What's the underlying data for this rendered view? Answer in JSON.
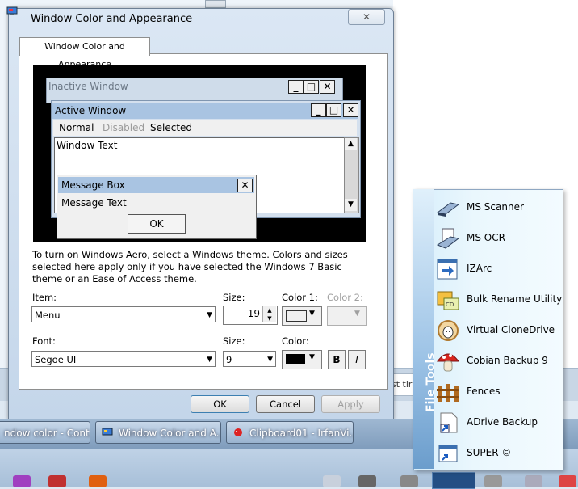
{
  "dialog": {
    "title": "Window Color and Appearance",
    "close_glyph": "✕",
    "tab_label": "Window Color and Appearance"
  },
  "preview": {
    "inactive_title": "Inactive Window",
    "active_title": "Active Window",
    "menu_normal": "Normal",
    "menu_disabled": "Disabled",
    "menu_selected": "Selected",
    "window_text": "Window Text",
    "msgbox_title": "Message Box",
    "msgbox_text": "Message Text",
    "msgbox_ok": "OK",
    "min_glyph": "_",
    "max_glyph": "□",
    "close_glyph": "✕",
    "up_glyph": "▲",
    "down_glyph": "▼"
  },
  "info_text": "To turn on Windows Aero, select a Windows theme.  Colors and sizes selected here apply only if you have selected the Windows 7 Basic theme or an Ease of Access theme.",
  "form": {
    "item_label": "Item:",
    "item_value": "Menu",
    "size1_label": "Size:",
    "size1_value": "19",
    "color1_label": "Color 1:",
    "color2_label": "Color 2:",
    "font_label": "Font:",
    "font_value": "Segoe UI",
    "size2_label": "Size:",
    "size2_value": "9",
    "color3_label": "Color:",
    "bold_label": "B",
    "italic_label": "I",
    "arrow": "▼"
  },
  "buttons": {
    "ok": "OK",
    "cancel": "Cancel",
    "apply": "Apply"
  },
  "taskbar": {
    "task1": "ndow color - Cont...",
    "task2": "Window Color and A...",
    "task3": "Clipboard01 - IrfanVi..."
  },
  "background": {
    "field_text": "st tir"
  },
  "jumplist": {
    "title": "File Tools",
    "items": [
      {
        "label": "MS Scanner",
        "icon": "scanner-icon"
      },
      {
        "label": "MS OCR",
        "icon": "ocr-icon"
      },
      {
        "label": "IZArc",
        "icon": "izarc-icon"
      },
      {
        "label": "Bulk Rename Utility",
        "icon": "bulk-rename-icon"
      },
      {
        "label": "Virtual CloneDrive",
        "icon": "clonedrive-sheep-icon"
      },
      {
        "label": "Cobian Backup 9",
        "icon": "cobian-mushroom-icon"
      },
      {
        "label": "Fences",
        "icon": "fences-icon"
      },
      {
        "label": "ADrive Backup",
        "icon": "adrive-icon"
      },
      {
        "label": "SUPER ©",
        "icon": "super-icon"
      }
    ]
  },
  "colors": {
    "active_caption": "#a9c4e2",
    "inactive_caption": "#cfdcea",
    "color3_swatch": "#000000"
  }
}
